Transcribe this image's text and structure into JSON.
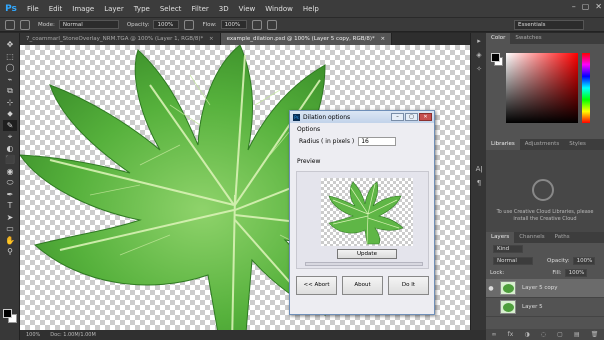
{
  "app": {
    "logo": "Ps"
  },
  "menu": [
    "File",
    "Edit",
    "Image",
    "Layer",
    "Type",
    "Select",
    "Filter",
    "3D",
    "View",
    "Window",
    "Help"
  ],
  "window_controls": [
    "–",
    "▢",
    "✕"
  ],
  "options": {
    "mode_label": "Mode:",
    "mode_value": "Normal",
    "opacity_label": "Opacity:",
    "opacity_value": "100%",
    "flow_label": "Flow:",
    "flow_value": "100%",
    "workspace": "Essentials"
  },
  "tabs": [
    {
      "label": "7_coammarl_StoneOverlay_NRM.TGA @ 100% (Layer 1, RGB/8)*",
      "close": "×"
    },
    {
      "label": "example_dilation.psd @ 100% (Layer 5 copy, RGB/8)*",
      "close": "×"
    }
  ],
  "tools": [
    "✥",
    "⬚",
    "◯",
    "⌁",
    "⧉",
    "⊹",
    "⬥",
    "✎",
    "⌖",
    "◐",
    "⬛",
    "◉",
    "⬭",
    "✒",
    "T",
    "➤",
    "▭",
    "✋",
    "⚲"
  ],
  "status": {
    "zoom": "100%",
    "doc": "Doc: 1.00M/1.00M"
  },
  "panels": {
    "color_tabs": [
      "Color",
      "Swatches"
    ],
    "library_tabs": [
      "Libraries",
      "Adjustments",
      "Styles"
    ],
    "library_message": "To use Creative Cloud Libraries, please install the Creative Cloud",
    "layers_tabs": [
      "Layers",
      "Channels",
      "Paths"
    ],
    "kind_label": "Kind",
    "blend_mode": "Normal",
    "opacity_label": "Opacity:",
    "opacity_value": "100%",
    "lock_label": "Lock:",
    "fill_label": "Fill:",
    "fill_value": "100%",
    "layers": [
      {
        "name": "Layer 5 copy",
        "visible_glyph": "●"
      },
      {
        "name": "Layer 5",
        "visible_glyph": ""
      }
    ],
    "footer_icons": [
      "∞",
      "fx",
      "◑",
      "◌",
      "▢",
      "▤",
      "🗑"
    ]
  },
  "dock_icons": [
    "▸",
    "◈",
    "✧",
    "Aǀ",
    "¶"
  ],
  "dialog": {
    "title": "Dilation options",
    "icon_text": "Ps",
    "buttons": [
      "–",
      "▢",
      "✕"
    ],
    "options_label": "Options",
    "radius_label": "Radius ( in pixels )",
    "radius_value": "16",
    "preview_label": "Preview",
    "update_label": "Update",
    "actions": [
      "<< Abort",
      "About",
      "Do It"
    ]
  }
}
